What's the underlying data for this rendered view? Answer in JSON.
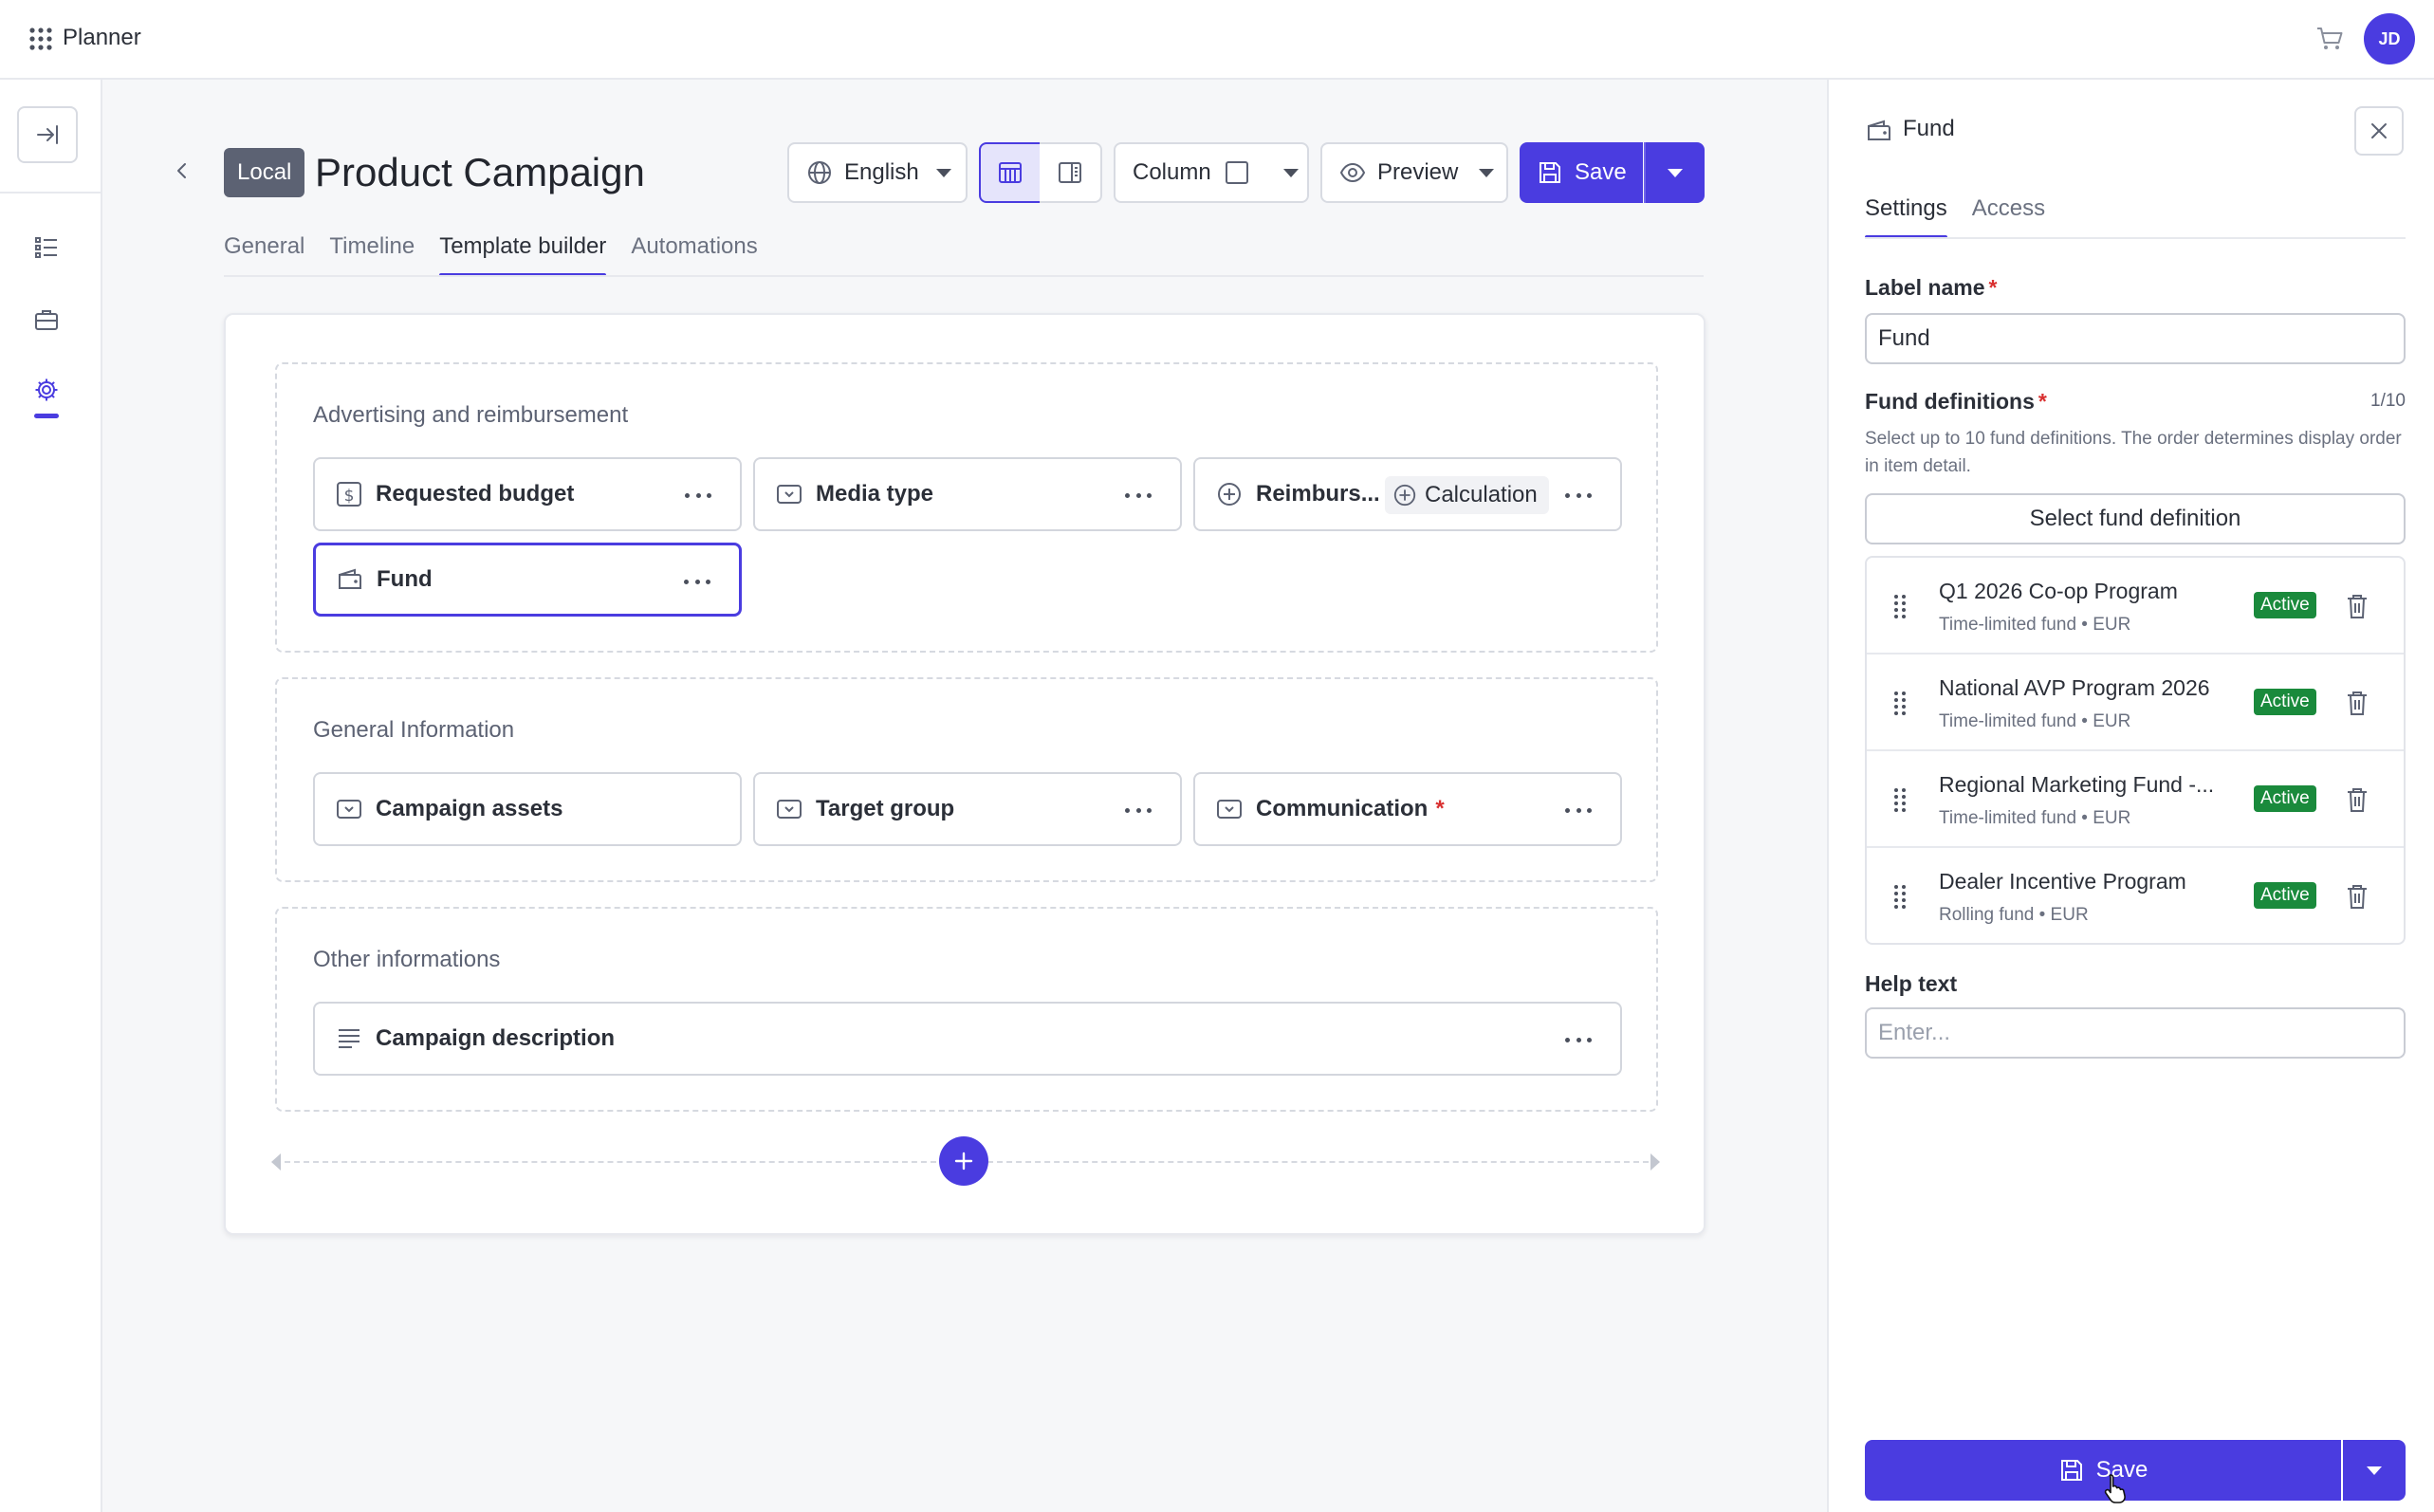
{
  "app": {
    "name": "Planner",
    "avatar_initials": "JD"
  },
  "header": {
    "badge": "Local",
    "title": "Product Campaign",
    "language": "English",
    "layout_label": "Column",
    "preview_label": "Preview",
    "save_label": "Save"
  },
  "tabs": [
    {
      "label": "General",
      "active": false
    },
    {
      "label": "Timeline",
      "active": false
    },
    {
      "label": "Template builder",
      "active": true
    },
    {
      "label": "Automations",
      "active": false
    }
  ],
  "sections": [
    {
      "title": "Advertising and reimbursement",
      "fields": [
        {
          "label": "Requested budget",
          "icon": "dollar-icon"
        },
        {
          "label": "Media type",
          "icon": "dropdown-field-icon"
        },
        {
          "label": "Reimburs...",
          "icon": "plus-circle-icon",
          "chip": "Calculation"
        },
        {
          "label": "Fund",
          "icon": "wallet-icon",
          "selected": true
        }
      ]
    },
    {
      "title": "General Information",
      "fields": [
        {
          "label": "Campaign assets",
          "icon": "dropdown-field-icon"
        },
        {
          "label": "Target group",
          "icon": "dropdown-field-icon"
        },
        {
          "label": "Communication",
          "icon": "dropdown-field-icon",
          "required": "*"
        }
      ]
    },
    {
      "title": "Other informations",
      "fields": [
        {
          "label": "Campaign description",
          "icon": "text-lines-icon"
        }
      ]
    }
  ],
  "panel": {
    "title": "Fund",
    "tabs": [
      {
        "label": "Settings",
        "active": true
      },
      {
        "label": "Access",
        "active": false
      }
    ],
    "label_name": {
      "label": "Label name",
      "required": "*",
      "value": "Fund"
    },
    "fund_definitions": {
      "label": "Fund definitions",
      "required": "*",
      "count": "1/10",
      "description": "Select up to 10 fund definitions. The order determines display order in item detail.",
      "select_button": "Select fund definition",
      "items": [
        {
          "name": "Q1 2026 Co-op Program",
          "sub": "Time-limited fund • EUR",
          "status": "Active"
        },
        {
          "name": "National AVP Program 2026",
          "sub": "Time-limited fund • EUR",
          "status": "Active"
        },
        {
          "name": "Regional Marketing Fund -...",
          "sub": "Time-limited fund • EUR",
          "status": "Active"
        },
        {
          "name": "Dealer Incentive Program",
          "sub": "Rolling fund • EUR",
          "status": "Active"
        }
      ]
    },
    "help_text": {
      "label": "Help text",
      "placeholder": "Enter..."
    },
    "save_label": "Save"
  },
  "colors": {
    "accent": "#4a3ce0",
    "active_badge": "#1a8a3c",
    "required": "#d93030"
  }
}
